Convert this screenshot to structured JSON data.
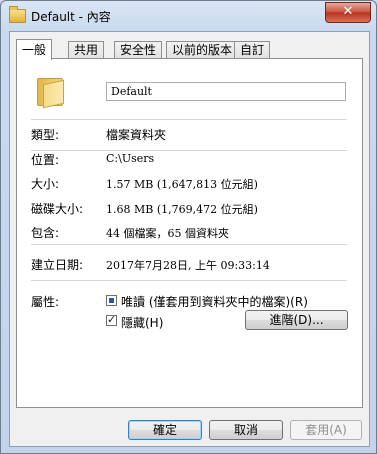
{
  "window": {
    "title": "Default - 內容",
    "close_symbol": "✕"
  },
  "tabs": [
    {
      "label": "一般",
      "active": true
    },
    {
      "label": "共用"
    },
    {
      "label": "安全性"
    },
    {
      "label": "以前的版本"
    },
    {
      "label": "自訂"
    }
  ],
  "general": {
    "folder_name": "Default",
    "type_label": "類型:",
    "type_value": "檔案資料夾",
    "location_label": "位置:",
    "location_value": "C:\\Users",
    "size_label": "大小:",
    "size_value": "1.57 MB (1,647,813 位元組)",
    "size_on_disk_label": "磁碟大小:",
    "size_on_disk_value": "1.68 MB (1,769,472 位元組)",
    "contains_label": "包含:",
    "contains_value": "44 個檔案，65 個資料夾",
    "created_label": "建立日期:",
    "created_value": "2017年7月28日, 上午 09:33:14",
    "attributes_label": "屬性:",
    "readonly_label": "唯讀 (僅套用到資料夾中的檔案)(R)",
    "readonly_state": "indeterminate",
    "hidden_label": "隱藏(H)",
    "hidden_state": "checked",
    "advanced_button": "進階(D)..."
  },
  "footer": {
    "ok": "確定",
    "cancel": "取消",
    "apply": "套用(A)"
  },
  "icons": {
    "title_icon": "folder-icon",
    "folder_large": "folder-icon"
  }
}
